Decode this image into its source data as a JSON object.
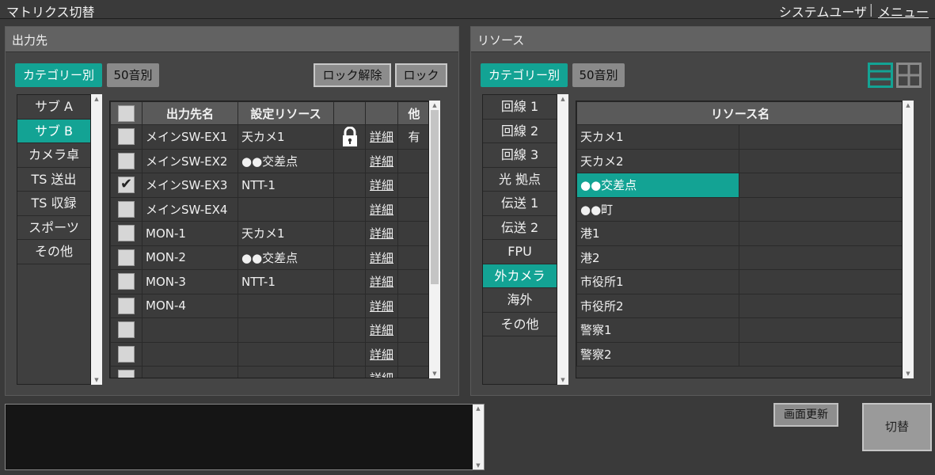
{
  "app": {
    "title": "マトリクス切替",
    "user": "システムユーザ",
    "separator": "|",
    "menu_label": "メニュー"
  },
  "output_panel": {
    "header": "出力先",
    "tab_category": "カテゴリー別",
    "tab_kana": "50音別",
    "unlock_label": "ロック解除",
    "lock_label": "ロック",
    "categories": [
      "サブ A",
      "サブ B",
      "カメラ卓",
      "TS 送出",
      "TS 収録",
      "スポーツ",
      "その他"
    ],
    "active_category_index": 1,
    "columns": {
      "name": "出力先名",
      "resource": "設定リソース",
      "detail": "",
      "other": "他"
    },
    "rows": [
      {
        "checked": false,
        "name": "メインSW-EX1",
        "resource": "天カメ1",
        "locked": true,
        "detail": "詳細",
        "other": "有"
      },
      {
        "checked": false,
        "name": "メインSW-EX2",
        "resource": "●●交差点",
        "locked": false,
        "detail": "詳細",
        "other": ""
      },
      {
        "checked": true,
        "name": "メインSW-EX3",
        "resource": "NTT-1",
        "locked": false,
        "detail": "詳細",
        "other": ""
      },
      {
        "checked": false,
        "name": "メインSW-EX4",
        "resource": "",
        "locked": false,
        "detail": "詳細",
        "other": ""
      },
      {
        "checked": false,
        "name": "MON-1",
        "resource": "天カメ1",
        "locked": false,
        "detail": "詳細",
        "other": ""
      },
      {
        "checked": false,
        "name": "MON-2",
        "resource": "●●交差点",
        "locked": false,
        "detail": "詳細",
        "other": ""
      },
      {
        "checked": false,
        "name": "MON-3",
        "resource": "NTT-1",
        "locked": false,
        "detail": "詳細",
        "other": ""
      },
      {
        "checked": false,
        "name": "MON-4",
        "resource": "",
        "locked": false,
        "detail": "詳細",
        "other": ""
      },
      {
        "checked": false,
        "name": "",
        "resource": "",
        "locked": false,
        "detail": "詳細",
        "other": ""
      },
      {
        "checked": false,
        "name": "",
        "resource": "",
        "locked": false,
        "detail": "詳細",
        "other": ""
      },
      {
        "checked": false,
        "name": "",
        "resource": "",
        "locked": false,
        "detail": "詳細",
        "other": ""
      }
    ]
  },
  "resource_panel": {
    "header": "リソース",
    "tab_category": "カテゴリー別",
    "tab_kana": "50音別",
    "categories": [
      "回線 1",
      "回線 2",
      "回線 3",
      "光 拠点",
      "伝送 1",
      "伝送 2",
      "FPU",
      "外カメラ",
      "海外",
      "その他"
    ],
    "active_category_index": 7,
    "column_header": "リソース名",
    "items": [
      "天カメ1",
      "天カメ2",
      "●●交差点",
      "●●町",
      "港1",
      "港2",
      "市役所1",
      "市役所2",
      "警察1",
      "警察2"
    ],
    "selected_index": 2
  },
  "actions": {
    "refresh_label": "画面更新",
    "switch_label": "切替"
  },
  "colors": {
    "accent": "#13a394",
    "panel": "#454545",
    "header": "#626262",
    "background": "#3a3a3a"
  },
  "icons": [
    "lock-icon",
    "list-view-icon",
    "grid-view-icon",
    "check-icon"
  ]
}
